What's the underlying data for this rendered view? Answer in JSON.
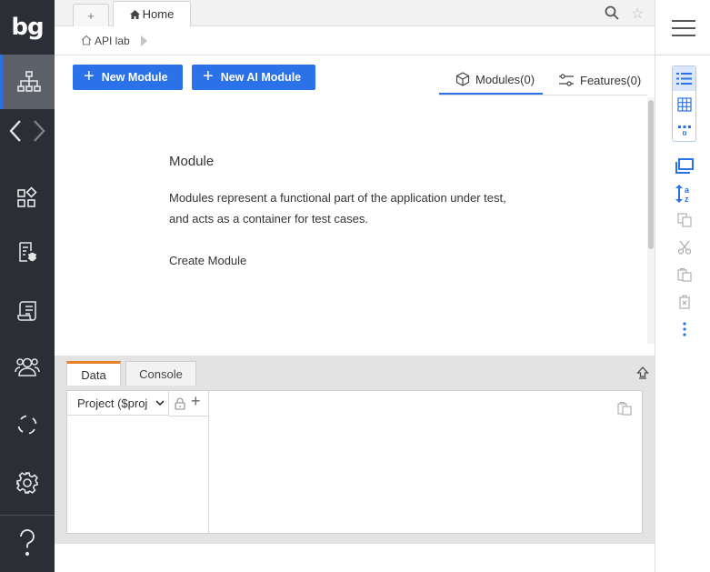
{
  "app": {
    "logo_text": "bg",
    "accent_color": "#2b72e8",
    "sidebar_bg": "#2b2e35"
  },
  "sidebar": {
    "items": [
      {
        "icon": "sitemap-icon",
        "active": true
      },
      {
        "icon": "arrows-left-right-icon"
      },
      {
        "icon": "widgets-icon"
      },
      {
        "icon": "bug-report-icon"
      },
      {
        "icon": "scroll-icon"
      },
      {
        "icon": "users-icon"
      },
      {
        "icon": "cycle-icon"
      },
      {
        "icon": "gear-icon"
      },
      {
        "icon": "help-icon"
      }
    ]
  },
  "tabs": {
    "add_label": "+",
    "home_label": "Home"
  },
  "breadcrumb": {
    "label": "API lab"
  },
  "toolbar": {
    "new_module_label": "New Module",
    "new_ai_module_label": "New AI Module"
  },
  "view_tabs": {
    "modules_label": "Modules(0)",
    "features_label": "Features(0)"
  },
  "content": {
    "title": "Module",
    "desc_line1": "Modules represent a functional part of the application under test,",
    "desc_line2": "and acts as a container for test cases.",
    "create_link": "Create Module"
  },
  "bottom_panel": {
    "tabs": [
      "Data",
      "Console"
    ],
    "active_tab": "Data",
    "project_select": "Project ($proj"
  }
}
